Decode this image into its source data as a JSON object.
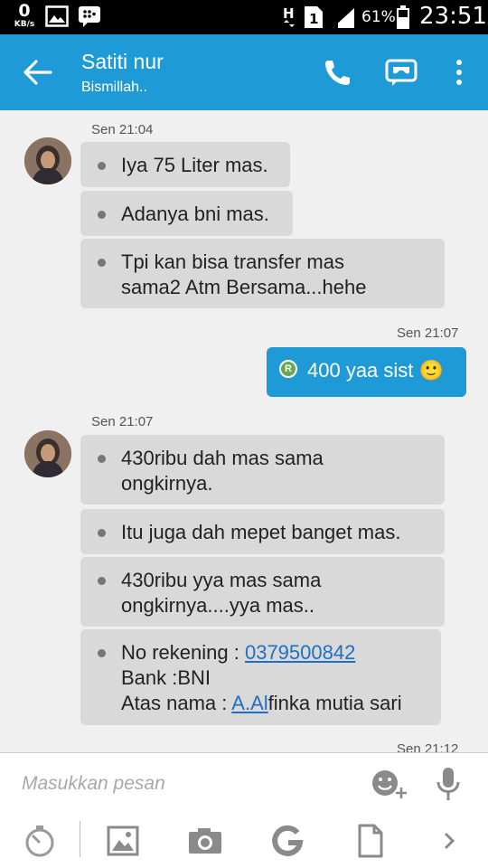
{
  "status_bar": {
    "speed_value": "0",
    "speed_unit": "KB/s",
    "battery_percent": "61%",
    "time": "23:51",
    "icons": [
      "image-icon",
      "blackberry-messenger-icon",
      "h-data-icon",
      "sim-1-icon",
      "signal-icon",
      "battery-icon"
    ]
  },
  "header": {
    "contact_name": "Satiti nur",
    "contact_status": "Bismillah..",
    "icons": [
      "back-arrow-icon",
      "phone-icon",
      "bbm-video-icon",
      "more-vert-icon"
    ],
    "color": "#1e9ad6"
  },
  "messages": [
    {
      "kind": "time",
      "text": "Sen 21:04"
    },
    {
      "kind": "in",
      "text": "Iya 75 Liter mas."
    },
    {
      "kind": "in",
      "text": "Adanya bni mas."
    },
    {
      "kind": "in",
      "line1": "Tpi kan bisa transfer mas",
      "line2": "sama2 Atm Bersama...hehe"
    },
    {
      "kind": "time",
      "text": "Sen 21:07"
    },
    {
      "kind": "out",
      "text": "400 yaa sist",
      "badge": "R",
      "emoji": "🙂"
    },
    {
      "kind": "time",
      "text": "Sen 21:07"
    },
    {
      "kind": "in",
      "line1": "430ribu dah mas sama",
      "line2": "ongkirnya."
    },
    {
      "kind": "in",
      "text": "Itu juga dah mepet banget mas."
    },
    {
      "kind": "in",
      "line1": "430ribu yya mas sama",
      "line2": "ongkirnya....yya mas.."
    },
    {
      "kind": "in",
      "rek_label": "No rekening : ",
      "rek_number": "0379500842",
      "bank": "Bank :BNI",
      "name_label": "Atas nama : ",
      "name_link": "A.Al",
      "name_rest": "finka mutia sari"
    },
    {
      "kind": "time",
      "text": "Sen 21:12"
    }
  ],
  "composer": {
    "placeholder": "Masukkan pesan",
    "icons": [
      "emoticon-add-icon",
      "microphone-icon"
    ]
  },
  "toolbar": {
    "icons": [
      "timer-icon",
      "image-icon",
      "camera-icon",
      "google-icon",
      "file-icon",
      "chevron-right-icon"
    ]
  },
  "colors": {
    "incoming_bubble": "#d9d9d9",
    "outgoing_bubble": "#1e9ad6",
    "link": "#1f6fc9"
  }
}
